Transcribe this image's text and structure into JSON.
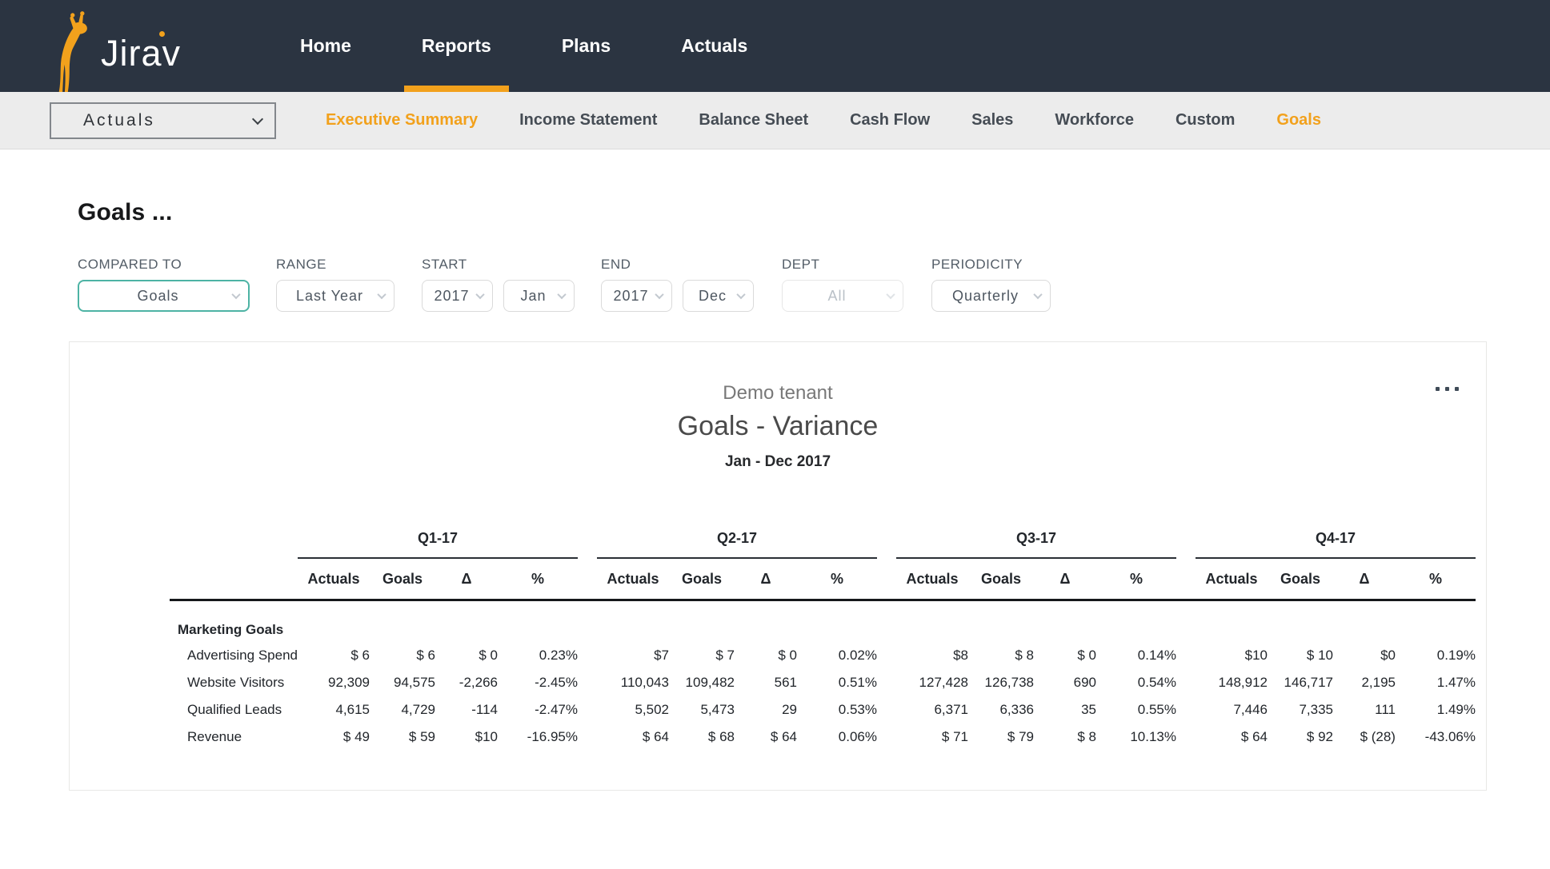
{
  "brand": {
    "name": "Jirav",
    "accent_color": "#F2A11C",
    "navy_color": "#2B3441",
    "teal_color": "#4DB3A4"
  },
  "icons": {
    "logo": "giraffe-logo",
    "select_chevron": "chevron-down",
    "card_menu": "ellipsis-horizontal"
  },
  "top_nav": {
    "items": [
      {
        "label": "Home",
        "active": false
      },
      {
        "label": "Reports",
        "active": true
      },
      {
        "label": "Plans",
        "active": false
      },
      {
        "label": "Actuals",
        "active": false
      }
    ]
  },
  "sub_nav": {
    "selector_value": "Actuals",
    "tabs": [
      {
        "label": "Executive Summary",
        "highlighted": true
      },
      {
        "label": "Income Statement",
        "highlighted": false
      },
      {
        "label": "Balance Sheet",
        "highlighted": false
      },
      {
        "label": "Cash Flow",
        "highlighted": false
      },
      {
        "label": "Sales",
        "highlighted": false
      },
      {
        "label": "Workforce",
        "highlighted": false
      },
      {
        "label": "Custom",
        "highlighted": false
      },
      {
        "label": "Goals",
        "highlighted": true
      }
    ]
  },
  "page": {
    "title": "Goals ..."
  },
  "filters": [
    {
      "label": "COMPARED TO",
      "controls": [
        {
          "value": "Goals",
          "accent": true,
          "disabled": false
        }
      ]
    },
    {
      "label": "RANGE",
      "controls": [
        {
          "value": "Last Year",
          "accent": false,
          "disabled": false
        }
      ]
    },
    {
      "label": "START",
      "controls": [
        {
          "value": "2017",
          "accent": false,
          "disabled": false
        },
        {
          "value": "Jan",
          "accent": false,
          "disabled": false
        }
      ]
    },
    {
      "label": "END",
      "controls": [
        {
          "value": "2017",
          "accent": false,
          "disabled": false
        },
        {
          "value": "Dec",
          "accent": false,
          "disabled": false
        }
      ]
    },
    {
      "label": "DEPT",
      "controls": [
        {
          "value": "All",
          "accent": false,
          "disabled": true
        }
      ]
    },
    {
      "label": "PERIODICITY",
      "controls": [
        {
          "value": "Quarterly",
          "accent": false,
          "disabled": false
        }
      ]
    }
  ],
  "report_card": {
    "company": "Demo tenant",
    "title": "Goals - Variance",
    "subtitle": "Jan - Dec 2017",
    "table": {
      "quarters": [
        "Q1-17",
        "Q2-17",
        "Q3-17",
        "Q4-17"
      ],
      "sub_headers": [
        "Actuals",
        "Goals",
        "Δ",
        "%"
      ],
      "section": "Marketing Goals",
      "rows": [
        {
          "label": "Advertising Spend",
          "cells": [
            "$ 6",
            "$ 6",
            "$ 0",
            "0.23%",
            "$7",
            "$ 7",
            "$ 0",
            "0.02%",
            "$8",
            "$ 8",
            "$ 0",
            "0.14%",
            "$10",
            "$ 10",
            "$0",
            "0.19%"
          ]
        },
        {
          "label": "Website Visitors",
          "cells": [
            "92,309",
            "94,575",
            "-2,266",
            "-2.45%",
            "110,043",
            "109,482",
            "561",
            "0.51%",
            "127,428",
            "126,738",
            "690",
            "0.54%",
            "148,912",
            "146,717",
            "2,195",
            "1.47%"
          ]
        },
        {
          "label": "Qualified Leads",
          "cells": [
            "4,615",
            "4,729",
            "-114",
            "-2.47%",
            "5,502",
            "5,473",
            "29",
            "0.53%",
            "6,371",
            "6,336",
            "35",
            "0.55%",
            "7,446",
            "7,335",
            "111",
            "1.49%"
          ]
        },
        {
          "label": "Revenue",
          "cells": [
            "$ 49",
            "$ 59",
            "$10",
            "-16.95%",
            "$  64",
            "$ 68",
            "$ 64",
            "0.06%",
            "$ 71",
            "$ 79",
            "$ 8",
            "10.13%",
            "$ 64",
            "$ 92",
            "$ (28)",
            "-43.06%"
          ]
        }
      ]
    }
  },
  "chart_data": {
    "type": "table",
    "title": "Goals - Variance",
    "subtitle": "Jan - Dec 2017",
    "company": "Demo tenant",
    "column_groups": [
      "Q1-17",
      "Q2-17",
      "Q3-17",
      "Q4-17"
    ],
    "columns_per_group": [
      "Actuals",
      "Goals",
      "Δ",
      "%"
    ],
    "section": "Marketing Goals",
    "rows": [
      {
        "metric": "Advertising Spend",
        "values": [
          "$ 6",
          "$ 6",
          "$ 0",
          "0.23%",
          "$7",
          "$ 7",
          "$ 0",
          "0.02%",
          "$8",
          "$ 8",
          "$ 0",
          "0.14%",
          "$10",
          "$ 10",
          "$0",
          "0.19%"
        ]
      },
      {
        "metric": "Website Visitors",
        "values": [
          92309,
          94575,
          -2266,
          "-2.45%",
          110043,
          109482,
          561,
          "0.51%",
          127428,
          126738,
          690,
          "0.54%",
          148912,
          146717,
          2195,
          "1.47%"
        ]
      },
      {
        "metric": "Qualified Leads",
        "values": [
          4615,
          4729,
          -114,
          "-2.47%",
          5502,
          5473,
          29,
          "0.53%",
          6371,
          6336,
          35,
          "0.55%",
          7446,
          7335,
          111,
          "1.49%"
        ]
      },
      {
        "metric": "Revenue",
        "values": [
          "$ 49",
          "$ 59",
          "$10",
          "-16.95%",
          "$ 64",
          "$ 68",
          "$ 64",
          "0.06%",
          "$ 71",
          "$ 79",
          "$ 8",
          "10.13%",
          "$ 64",
          "$ 92",
          "$ (28)",
          "-43.06%"
        ]
      }
    ]
  }
}
